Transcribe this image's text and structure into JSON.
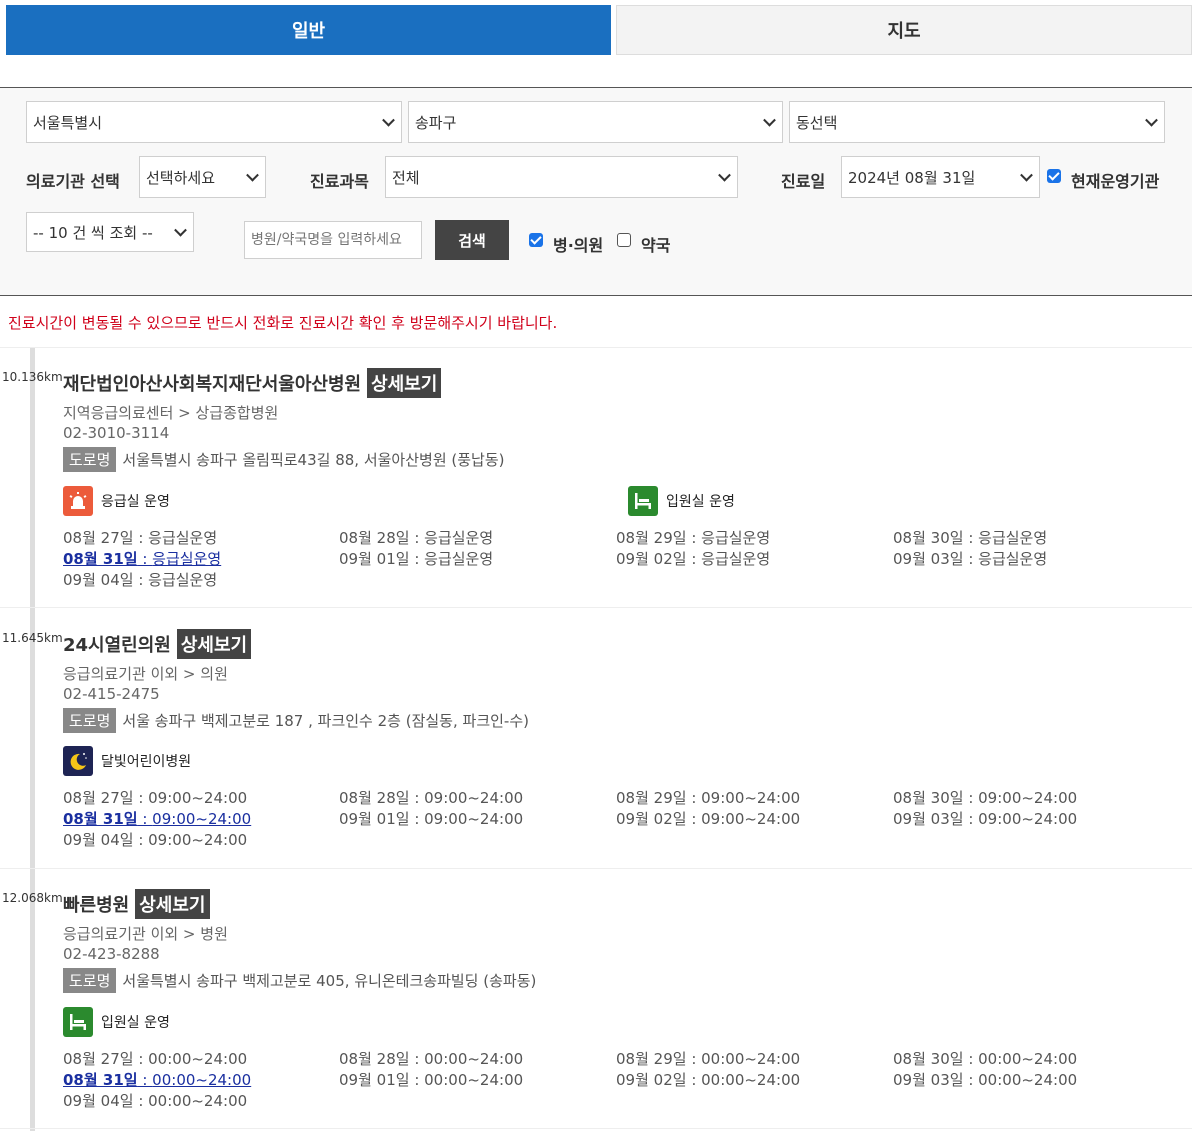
{
  "tabs": {
    "general": "일반",
    "map": "지도"
  },
  "filter": {
    "city": "서울특별시",
    "district": "송파구",
    "dong": "동선택",
    "institution_label": "의료기관 선택",
    "institution_value": "선택하세요",
    "department_label": "진료과목",
    "department_value": "전체",
    "date_label": "진료일",
    "date_value": "2024년 08월 31일",
    "operating_label": "현재운영기관",
    "count_value": "-- 10 건 씩 조회 --",
    "search_placeholder": "병원/약국명을 입력하세요",
    "search_button": "검색",
    "hospital_label": "병·의원",
    "pharmacy_label": "약국"
  },
  "notice": "진료시간이 변동될 수 있으므로 반드시 전화로 진료시간 확인 후 방문해주시기 바랍니다.",
  "detail_label": "상세보기",
  "road_label": "도로명",
  "colors": {
    "tab_active": "#1a6fc0",
    "notice": "#d0021b",
    "today": "#1a2fa0"
  },
  "hospitals": [
    {
      "distance": "10.136km",
      "name": "재단법인아산사회복지재단서울아산병원",
      "category": "지역응급의료센터 > 상급종합병원",
      "phone": "02-3010-3114",
      "address": "서울특별시 송파구 올림픽로43길 88, 서울아산병원 (풍납동)",
      "services": [
        {
          "icon": "emergency-siren-icon",
          "label": "응급실 운영"
        },
        {
          "icon": "inpatient-bed-icon",
          "label": "입원실 운영"
        }
      ],
      "schedule": [
        {
          "date": "08월 27일",
          "time": "응급실운영"
        },
        {
          "date": "08월 28일",
          "time": "응급실운영"
        },
        {
          "date": "08월 29일",
          "time": "응급실운영"
        },
        {
          "date": "08월 30일",
          "time": "응급실운영"
        },
        {
          "date": "08월 31일",
          "time": "응급실운영"
        },
        {
          "date": "09월 01일",
          "time": "응급실운영"
        },
        {
          "date": "09월 02일",
          "time": "응급실운영"
        },
        {
          "date": "09월 03일",
          "time": "응급실운영"
        },
        {
          "date": "09월 04일",
          "time": "응급실운영"
        }
      ]
    },
    {
      "distance": "11.645km",
      "name": "24시열린의원",
      "category": "응급의료기관 이외 > 의원",
      "phone": "02-415-2475",
      "address": "서울 송파구 백제고분로 187 , 파크인수 2층 (잠실동, 파크인-수)",
      "services": [
        {
          "icon": "moon-night-icon",
          "label": "달빛어린이병원"
        }
      ],
      "schedule": [
        {
          "date": "08월 27일",
          "time": "09:00~24:00"
        },
        {
          "date": "08월 28일",
          "time": "09:00~24:00"
        },
        {
          "date": "08월 29일",
          "time": "09:00~24:00"
        },
        {
          "date": "08월 30일",
          "time": "09:00~24:00"
        },
        {
          "date": "08월 31일",
          "time": "09:00~24:00"
        },
        {
          "date": "09월 01일",
          "time": "09:00~24:00"
        },
        {
          "date": "09월 02일",
          "time": "09:00~24:00"
        },
        {
          "date": "09월 03일",
          "time": "09:00~24:00"
        },
        {
          "date": "09월 04일",
          "time": "09:00~24:00"
        }
      ]
    },
    {
      "distance": "12.068km",
      "name": "빠른병원",
      "category": "응급의료기관 이외 > 병원",
      "phone": "02-423-8288",
      "address": "서울특별시 송파구 백제고분로 405, 유니온테크송파빌딩 (송파동)",
      "services": [
        {
          "icon": "inpatient-bed-icon",
          "label": "입원실 운영"
        }
      ],
      "schedule": [
        {
          "date": "08월 27일",
          "time": "00:00~24:00"
        },
        {
          "date": "08월 28일",
          "time": "00:00~24:00"
        },
        {
          "date": "08월 29일",
          "time": "00:00~24:00"
        },
        {
          "date": "08월 30일",
          "time": "00:00~24:00"
        },
        {
          "date": "08월 31일",
          "time": "00:00~24:00"
        },
        {
          "date": "09월 01일",
          "time": "00:00~24:00"
        },
        {
          "date": "09월 02일",
          "time": "00:00~24:00"
        },
        {
          "date": "09월 03일",
          "time": "00:00~24:00"
        },
        {
          "date": "09월 04일",
          "time": "00:00~24:00"
        }
      ]
    }
  ]
}
